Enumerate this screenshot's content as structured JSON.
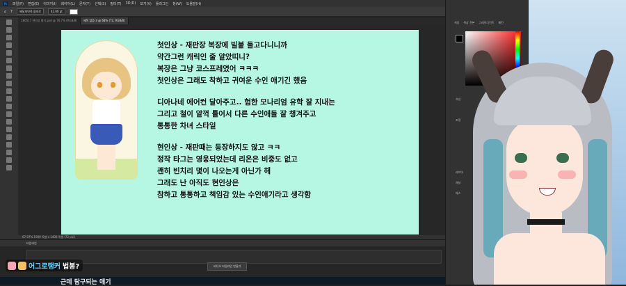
{
  "menubar": {
    "items": [
      "파일(F)",
      "편집(E)",
      "이미지(I)",
      "레이어(L)",
      "문자(Y)",
      "선택(S)",
      "필터(T)",
      "3D(D)",
      "보기(V)",
      "플러그인",
      "창(W)",
      "도움말(H)"
    ]
  },
  "optbar": {
    "font": "배달의민족 을지로",
    "size": "42.00 pt"
  },
  "tabs": [
    {
      "label": "180517 현인상 평가.psd @ 76.7% (RGB/8)",
      "active": false
    },
    {
      "label": "제목 없음-3 @ 68% (T2, RGB/8)",
      "active": true
    }
  ],
  "canvas": {
    "lines": [
      [
        "첫인상 - 재판장 복장에 빌붙 들고다니니까",
        "약간그런 캐릭인 줄 알았띠니?",
        "복장은 그냥 코스프레였어 ㅋㅋㅋ",
        "첫인상은 그래도 착하고 귀여운 수인 애기긴 했음"
      ],
      [
        "디아나네 에어컨 달아주고.. 험한 모나리엄 유학 잘 지내는",
        "그리고 철이 알꺽 틀어서 다른 수인애들 잘 챙겨주고",
        "통통한 차녀 스타일"
      ],
      [
        "현인상 - 재판때는 등장하지도 않고 ㅋㅋ",
        "정작 타그는 영웅되었는데 리온은 비중도 없고",
        "괜히 빈치리 몇이 나오는게 아닌가 해",
        "그래도 난 아직도 현인상은",
        "참하고 통통하고 책임감 있는 수인애기라고 생각함"
      ]
    ]
  },
  "statusbar": {
    "text": "67.97%  1900 픽셀 x 1400 픽셀 (72 ppi)"
  },
  "timeline": {
    "title": "타임라인",
    "button": "비디오 타임라인 만들기"
  },
  "chat": {
    "user": "어그로탱커",
    "message": "법봉?"
  },
  "subtitle": {
    "text": "근데 탐구되는 애기"
  },
  "rpanel": {
    "tabs": [
      "색상",
      "색상 견본",
      "그레이디언트",
      "패턴"
    ],
    "rows": [
      "속성",
      "조정",
      "레이어",
      "채널",
      "패스"
    ]
  },
  "colors": {
    "canvas_bg": "#b6f7e4",
    "chat_user": "#6dd1ff",
    "ps_dark": "#323232"
  }
}
